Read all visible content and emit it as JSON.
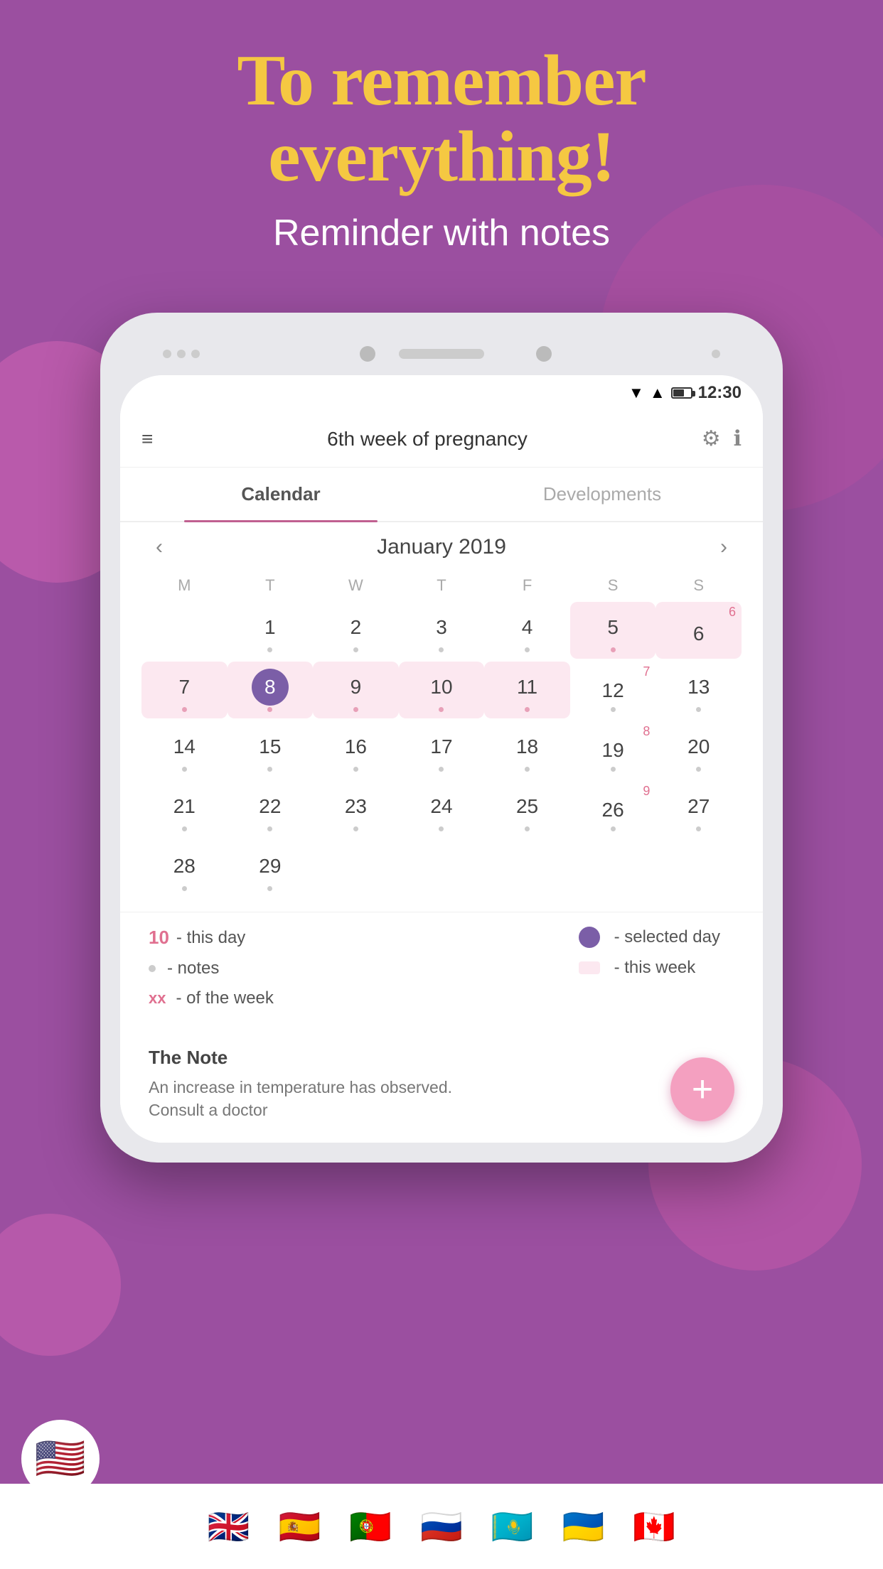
{
  "background": {
    "color": "#9b4fa0"
  },
  "header": {
    "title_line1": "To remember",
    "title_line2": "everything!",
    "subtitle": "Reminder with notes"
  },
  "phone": {
    "status_time": "12:30",
    "app_title": "6th week of pregnancy",
    "tabs": [
      {
        "label": "Calendar",
        "active": true
      },
      {
        "label": "Developments",
        "active": false
      }
    ],
    "calendar": {
      "month_year": "January 2019",
      "day_headers": [
        "M",
        "T",
        "W",
        "T",
        "F",
        "S",
        "S"
      ],
      "weeks": [
        [
          {
            "num": "",
            "empty": true
          },
          {
            "num": "1",
            "dot": true
          },
          {
            "num": "2",
            "dot": true
          },
          {
            "num": "3",
            "dot": true
          },
          {
            "num": "4",
            "dot": true
          },
          {
            "num": "5",
            "highlight": true,
            "dot": true,
            "pink_dot": true
          },
          {
            "num": "6",
            "highlight": true,
            "week_num": "6",
            "dot": false
          }
        ],
        [
          {
            "num": "7",
            "highlight": true,
            "dot": true
          },
          {
            "num": "8",
            "highlight": true,
            "selected": true,
            "dot": true
          },
          {
            "num": "9",
            "highlight": true,
            "dot": true
          },
          {
            "num": "10",
            "highlight": true,
            "dot": true
          },
          {
            "num": "11",
            "highlight": true,
            "dot": true
          },
          {
            "num": "12",
            "week_num": "7",
            "dot": true
          },
          {
            "num": "13",
            "dot": true
          }
        ],
        [
          {
            "num": "14",
            "dot": true
          },
          {
            "num": "15",
            "dot": true
          },
          {
            "num": "16",
            "dot": true
          },
          {
            "num": "17",
            "dot": true
          },
          {
            "num": "18",
            "dot": true
          },
          {
            "num": "19",
            "week_num": "8",
            "dot": true
          },
          {
            "num": "20",
            "dot": true
          }
        ],
        [
          {
            "num": "21",
            "dot": true
          },
          {
            "num": "22",
            "dot": true
          },
          {
            "num": "23",
            "dot": true
          },
          {
            "num": "24",
            "dot": true
          },
          {
            "num": "25",
            "dot": true
          },
          {
            "num": "26",
            "week_num": "9",
            "dot": true
          },
          {
            "num": "27",
            "dot": true
          }
        ],
        [
          {
            "num": "28",
            "dot": true
          },
          {
            "num": "29",
            "dot": true
          },
          {
            "num": "",
            "empty": true
          },
          {
            "num": "",
            "empty": true
          },
          {
            "num": "",
            "empty": true
          },
          {
            "num": "",
            "empty": true
          },
          {
            "num": "",
            "empty": true
          }
        ]
      ]
    },
    "legend": {
      "this_day_label": "- this day",
      "this_day_number": "10",
      "notes_label": "- notes",
      "week_label": "- of the week",
      "selected_day_label": "- selected day",
      "this_week_label": "- this week"
    },
    "note": {
      "title": "The Note",
      "text": "An increase in temperature has observed.\nConsult a doctor"
    },
    "fab_label": "+"
  },
  "flags": [
    "🇺🇸",
    "🇬🇧",
    "🇪🇸",
    "🇵🇹",
    "🇷🇺",
    "🇰🇿",
    "🇺🇦",
    "🇨🇦"
  ]
}
